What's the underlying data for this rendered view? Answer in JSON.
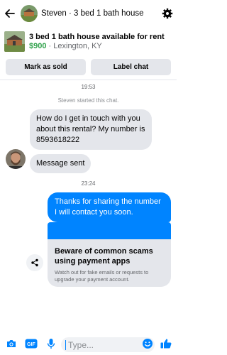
{
  "header": {
    "title": "Steven · 3 bed 1 bath house",
    "back_icon": "back-arrow-icon",
    "settings_icon": "gear-icon"
  },
  "listing": {
    "title": "3 bed 1 bath house available for rent",
    "price": "$900",
    "location": " · Lexington, KY"
  },
  "actions": {
    "mark_sold": "Mark as sold",
    "label_chat": "Label chat"
  },
  "thread": {
    "time1": "19:53",
    "system_note": "Steven started this chat.",
    "msg_in_1": "How do I get in touch with you about this rental? My number is 8593618222",
    "msg_in_2": "Message sent",
    "time2": "23:24",
    "msg_out_1": "Thanks for sharing the number I will contact you soon.",
    "scam_card": {
      "title": "Beware of common scams using payment apps",
      "text": "Watch out for fake emails or requests to upgrade your payment account."
    }
  },
  "composer": {
    "placeholder": "Type...",
    "icons": [
      "camera-icon",
      "gif-icon",
      "microphone-icon",
      "emoji-icon",
      "thumbs-up-icon"
    ]
  },
  "colors": {
    "accent": "#0084ff",
    "price": "#31a24c",
    "bubble_gray": "#e4e6eb"
  }
}
